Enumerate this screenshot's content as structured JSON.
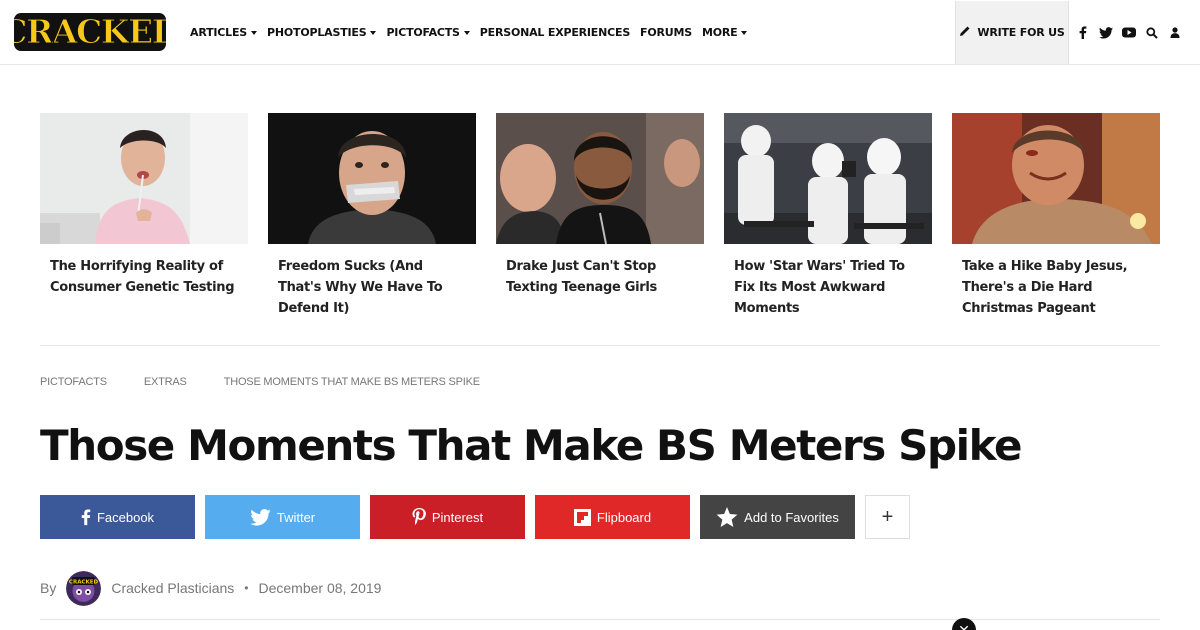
{
  "site": {
    "logo_text": "CRACKED"
  },
  "nav": {
    "items": [
      {
        "label": "ARTICLES",
        "has_dropdown": true
      },
      {
        "label": "PHOTOPLASTIES",
        "has_dropdown": true
      },
      {
        "label": "PICTOFACTS",
        "has_dropdown": true
      },
      {
        "label": "PERSONAL EXPERIENCES",
        "has_dropdown": false
      },
      {
        "label": "FORUMS",
        "has_dropdown": false
      },
      {
        "label": "MORE",
        "has_dropdown": true
      }
    ],
    "write_label": "WRITE FOR US",
    "icons": [
      "facebook-icon",
      "twitter-icon",
      "youtube-icon",
      "search-icon",
      "user-icon"
    ]
  },
  "trending": [
    {
      "title": "The Horrifying Reality of Consumer Genetic Testing",
      "image": "man-swabbing-mouth"
    },
    {
      "title": "Freedom Sucks (And That's Why We Have To Defend It)",
      "image": "man-with-taped-mouth"
    },
    {
      "title": "Drake Just Can't Stop Texting Teenage Girls",
      "image": "drake-portrait"
    },
    {
      "title": "How 'Star Wars' Tried To Fix Its Most Awkward Moments",
      "image": "stormtroopers"
    },
    {
      "title": "Take a Hike Baby Jesus, There's a Die Hard Christmas Pageant",
      "image": "die-hard-still"
    }
  ],
  "breadcrumb": [
    "PICTOFACTS",
    "EXTRAS",
    "THOSE MOMENTS THAT MAKE BS METERS SPIKE"
  ],
  "article": {
    "title": "Those Moments That Make BS Meters Spike",
    "byline_prefix": "By",
    "author": "Cracked Plasticians",
    "date": "December 08, 2019"
  },
  "share": {
    "facebook": "Facebook",
    "twitter": "Twitter",
    "pinterest": "Pinterest",
    "flipboard": "Flipboard",
    "favorites": "Add to Favorites",
    "more": "+"
  },
  "colors": {
    "facebook": "#3b5998",
    "twitter": "#55acee",
    "pinterest": "#cb1f27",
    "flipboard": "#e12828",
    "favorites": "#444444",
    "logo_yellow": "#f6c81a"
  }
}
